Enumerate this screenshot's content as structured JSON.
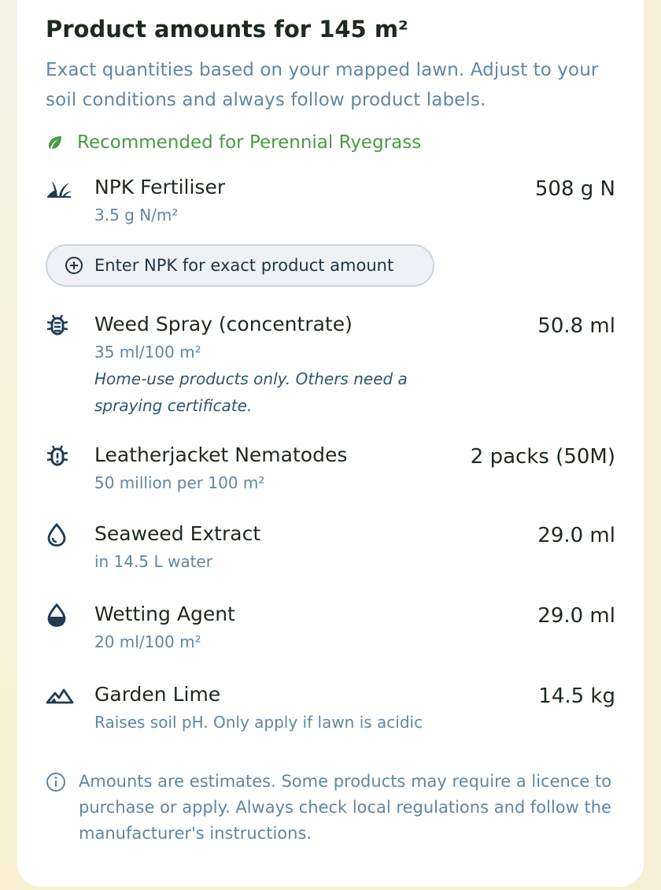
{
  "header": {
    "title": "Product amounts for 145 m²",
    "subtitle": "Exact quantities based on your mapped lawn. Adjust to your soil conditions and always follow product labels."
  },
  "recommended": {
    "label": "Recommended for Perennial Ryegrass",
    "icon": "leaf-icon",
    "color": "#4a9a45"
  },
  "products": {
    "npk": {
      "name": "NPK Fertiliser",
      "rate": "3.5 g N/m²",
      "amount": "508 g N",
      "icon": "grass-icon",
      "button_label": "Enter NPK for exact product amount"
    },
    "weed": {
      "name": "Weed Spray (concentrate)",
      "rate": "35 ml/100 m²",
      "note": "Home-use products only. Others need a spraying certificate.",
      "amount": "50.8 ml",
      "icon": "bug-icon"
    },
    "nematodes": {
      "name": "Leatherjacket Nematodes",
      "rate": "50 million per 100 m²",
      "amount": "2 packs (50M)",
      "icon": "bug-alert-icon"
    },
    "seaweed": {
      "name": "Seaweed Extract",
      "rate": "in 14.5 L water",
      "amount": "29.0 ml",
      "icon": "drop-icon"
    },
    "wetting": {
      "name": "Wetting Agent",
      "rate": "20 ml/100 m²",
      "amount": "29.0 ml",
      "icon": "drop-half-icon"
    },
    "lime": {
      "name": "Garden Lime",
      "rate": "Raises soil pH. Only apply if lawn is acidic",
      "amount": "14.5 kg",
      "icon": "mountain-icon"
    }
  },
  "disclaimer": {
    "text": "Amounts are estimates. Some products may require a licence to purchase or apply. Always check local regulations and follow the manufacturer's instructions.",
    "icon": "info-icon"
  },
  "colors": {
    "accent_text": "#5f87a3",
    "heading": "#1d2a1f",
    "icon": "#1f3b55"
  }
}
